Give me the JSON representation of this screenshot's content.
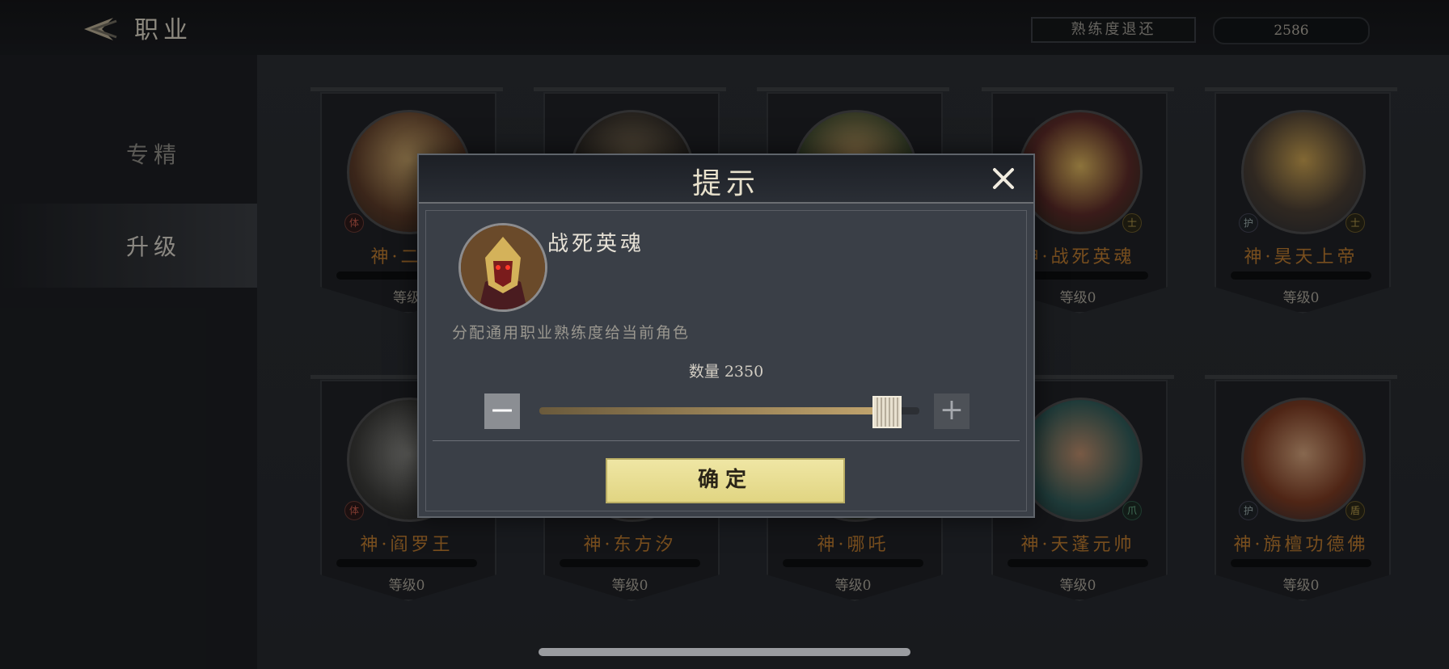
{
  "header": {
    "title": "职业",
    "return_button": "熟练度退还",
    "points": "2586"
  },
  "sidebar": {
    "items": [
      {
        "label": "专精"
      },
      {
        "label": "升级"
      }
    ]
  },
  "cards": [
    {
      "name": "神·二郎",
      "level": "等级",
      "badge_left": "体",
      "badge_right": ""
    },
    {
      "name": "",
      "level": "",
      "badge_left": "",
      "badge_right": ""
    },
    {
      "name": "",
      "level": "",
      "badge_left": "",
      "badge_right": ""
    },
    {
      "name": "神·战死英魂",
      "level": "等级0",
      "badge_left": "",
      "badge_right": "士"
    },
    {
      "name": "神·昊天上帝",
      "level": "等级0",
      "badge_left": "护",
      "badge_right": "士"
    },
    {
      "name": "神·阎罗王",
      "level": "等级0",
      "badge_left": "体",
      "badge_right": ""
    },
    {
      "name": "神·东方汐",
      "level": "等级0",
      "badge_left": "",
      "badge_right": ""
    },
    {
      "name": "神·哪吒",
      "level": "等级0",
      "badge_left": "",
      "badge_right": ""
    },
    {
      "name": "神·天蓬元帅",
      "level": "等级0",
      "badge_left": "",
      "badge_right": "爪"
    },
    {
      "name": "神·旃檀功德佛",
      "level": "等级0",
      "badge_left": "护",
      "badge_right": "盾"
    }
  ],
  "dialog": {
    "title": "提示",
    "hero_name": "战死英魂",
    "description": "分配通用职业熟练度给当前角色",
    "quantity_label": "数量",
    "quantity_value": "2350",
    "quantity_max": "2586",
    "slider_fraction": 0.91,
    "minus": "−",
    "plus": "+",
    "confirm": "确定"
  },
  "colors": {
    "accent_gold": "#b9792f",
    "confirm_bg": "#e9df94"
  }
}
